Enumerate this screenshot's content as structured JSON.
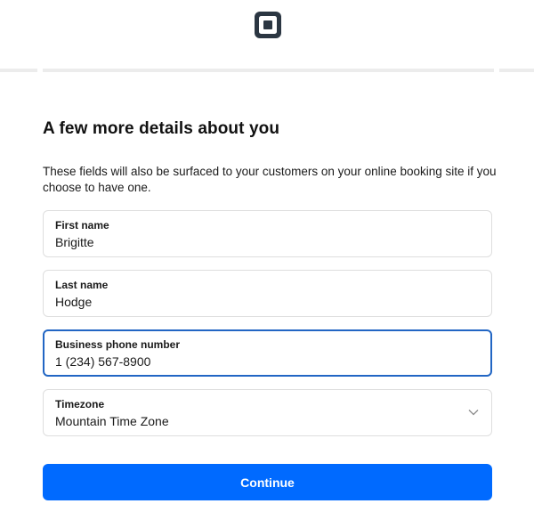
{
  "header": {
    "logo_icon": "square-logo-icon"
  },
  "form": {
    "title": "A few more details about you",
    "description": "These fields will also be surfaced to your customers on your online booking site if you choose to have one.",
    "fields": [
      {
        "label": "First name",
        "value": "Brigitte"
      },
      {
        "label": "Last name",
        "value": "Hodge"
      },
      {
        "label": "Business phone number",
        "value": "1 (234) 567-8900"
      },
      {
        "label": "Timezone",
        "value": "Mountain Time Zone",
        "icon": "chevron-down-icon"
      }
    ],
    "continue_label": "Continue"
  },
  "colors": {
    "accent": "#006aff",
    "focus_border": "#2266c4",
    "field_border": "#dedede",
    "logo": "#2b3642"
  }
}
